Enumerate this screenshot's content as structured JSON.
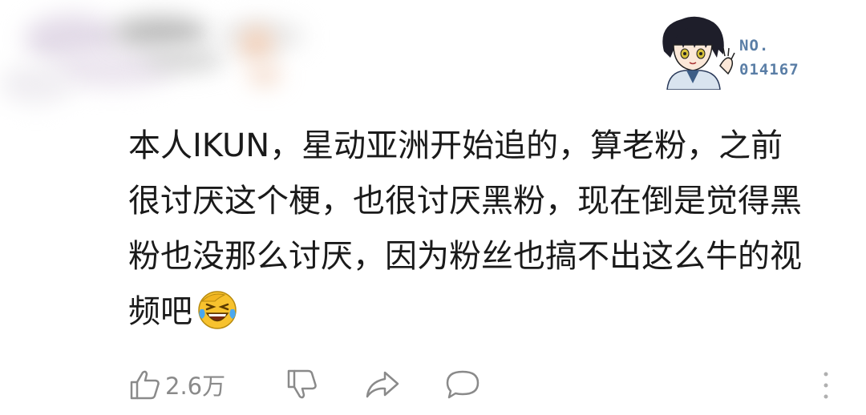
{
  "header": {
    "badge_line1": "NO.",
    "badge_line2": "014167",
    "avatar_icon": "anime-character-avatar"
  },
  "comment": {
    "lines": [
      "本人IKUN，星动亚洲开始追的，算老粉，之前",
      "很讨厌这个梗，也很讨厌黑粉，现在倒是觉得黑",
      "粉也没那么讨厌，因为粉丝也搞不出这么牛的视",
      "频吧"
    ],
    "emoji": "laughing-crying-emoji"
  },
  "actions": {
    "like_count": "2.6万",
    "like_icon": "thumbs-up-icon",
    "dislike_icon": "thumbs-down-icon",
    "share_icon": "share-arrow-icon",
    "reply_icon": "comment-bubble-icon",
    "more_icon": "more-dots-icon"
  },
  "colors": {
    "text": "#1a1a1a",
    "muted": "#8a8a8a",
    "badge": "#5a7ea6",
    "emoji_yellow": "#f7c22e"
  }
}
